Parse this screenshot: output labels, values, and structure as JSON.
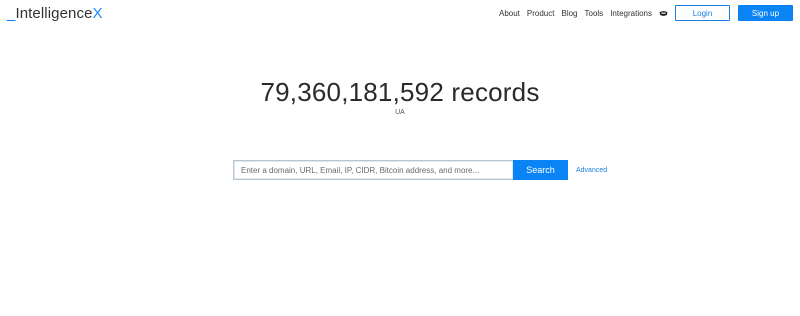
{
  "header": {
    "logo": {
      "underscore": "_",
      "main": "Intelligence",
      "x": "X"
    },
    "nav": [
      {
        "label": "About"
      },
      {
        "label": "Product"
      },
      {
        "label": "Blog"
      },
      {
        "label": "Tools"
      },
      {
        "label": "Integrations"
      }
    ],
    "icons": [
      "ninja-hat-icon",
      "calendar-list-icon"
    ],
    "login_label": "Login",
    "signup_label": "Sign up"
  },
  "main": {
    "records_text": "79,360,181,592 records",
    "subtitle": "UA",
    "search": {
      "placeholder": "Enter a domain, URL, Email, IP, CIDR, Bitcoin address, and more...",
      "value": "",
      "button_label": "Search"
    },
    "advanced_label": "Advanced"
  },
  "colors": {
    "accent": "#0a84f5",
    "link": "#1a7fe0",
    "text": "#2a2a2a"
  }
}
